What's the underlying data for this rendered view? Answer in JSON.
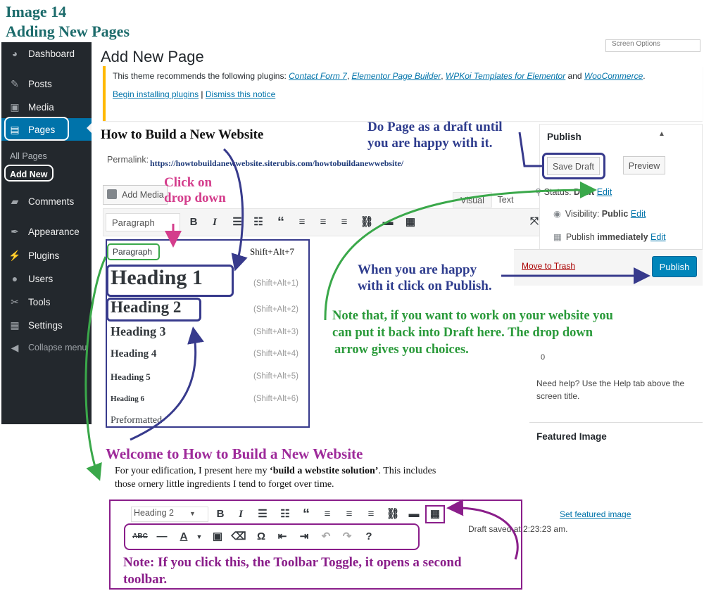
{
  "header": {
    "line1": "Image 14",
    "line2": "Adding New Pages"
  },
  "sidebar": {
    "items": [
      {
        "label": "Dashboard",
        "icon": "dashboard-icon"
      },
      {
        "label": "Posts",
        "icon": "pin-icon"
      },
      {
        "label": "Media",
        "icon": "media-icon"
      },
      {
        "label": "Pages",
        "icon": "pages-icon"
      },
      {
        "label": "Comments",
        "icon": "comment-icon"
      },
      {
        "label": "Appearance",
        "icon": "brush-icon"
      },
      {
        "label": "Plugins",
        "icon": "plug-icon"
      },
      {
        "label": "Users",
        "icon": "user-icon"
      },
      {
        "label": "Tools",
        "icon": "wrench-icon"
      },
      {
        "label": "Settings",
        "icon": "settings-icon"
      },
      {
        "label": "Collapse menu",
        "icon": "collapse-icon"
      }
    ],
    "sub": {
      "all_pages": "All Pages",
      "add_new": "Add New"
    },
    "accent": "#0073aa"
  },
  "page": {
    "title": "Add New Page",
    "screen_options": "Screen Options"
  },
  "notice": {
    "prefix": "This theme recommends the following plugins: ",
    "plugin1": "Contact Form 7",
    "plugin2": "Elementor Page Builder",
    "plugin3": "WPKoi Templates for Elementor",
    "and": " and ",
    "plugin4": "WooCommerce",
    "begin": "Begin installing plugins",
    "dismiss": "Dismiss this notice"
  },
  "editor": {
    "post_title": "How to Build a New Website",
    "permalink_label": "Permalink:",
    "permalink_url": "https://howtobuildanewwebsite.siterubis.com/howtobuildanewwebsite/",
    "add_media": "Add Media",
    "tab_visual": "Visual",
    "tab_text": "Text",
    "format_select": "Paragraph",
    "dropdown": [
      {
        "label": "Paragraph",
        "shortcut": "Shift+Alt+7"
      },
      {
        "label": "Heading 1",
        "shortcut": "(Shift+Alt+1)"
      },
      {
        "label": "Heading 2",
        "shortcut": "(Shift+Alt+2)"
      },
      {
        "label": "Heading 3",
        "shortcut": "(Shift+Alt+3)"
      },
      {
        "label": "Heading 4",
        "shortcut": "(Shift+Alt+4)"
      },
      {
        "label": "Heading 5",
        "shortcut": "(Shift+Alt+5)"
      },
      {
        "label": "Heading 6",
        "shortcut": "(Shift+Alt+6)"
      },
      {
        "label": "Preformatted",
        "shortcut": ""
      }
    ],
    "content_heading": "Welcome to How to Build a New Website",
    "content_line1_a": "For your edification, I present here my ",
    "content_line1_b": "‘build a webstite solution’",
    "content_line1_c": ". This includes",
    "content_line2": "those ornery little ingredients I tend to forget over time.",
    "toolbar2_select": "Heading 2"
  },
  "publish": {
    "heading": "Publish",
    "save_draft": "Save Draft",
    "preview": "Preview",
    "status_label": "Status: ",
    "status_value": "Draft",
    "edit": "Edit",
    "visibility_label": "Visibility: ",
    "visibility_value": "Public",
    "publish_label": "Publish ",
    "publish_value": "immediately",
    "move_to_trash": "Move to Trash",
    "publish_button": "Publish",
    "button_color": "#0085ba"
  },
  "help": {
    "char": "0",
    "text": "Need help? Use the Help tab above the screen title.",
    "featured_image": "Featured Image",
    "set_featured": "Set featured image",
    "draft_saved": "Draft saved at 2:23:23 am."
  },
  "annotations": {
    "click_dropdown_1": "Click on",
    "click_dropdown_2": "drop down",
    "draft_1": "Do Page as a draft until",
    "draft_2": "you are happy with it.",
    "publish_1": "When you are happy",
    "publish_2": "with it click on Publish.",
    "green_1": "Note that, if you want to work on your website you",
    "green_2": "can put it back into Draft here. The drop down",
    "green_3": "arrow gives you choices.",
    "purple_1": "Note: If you click this, the Toolbar Toggle, it opens a second",
    "purple_2": "toolbar."
  }
}
